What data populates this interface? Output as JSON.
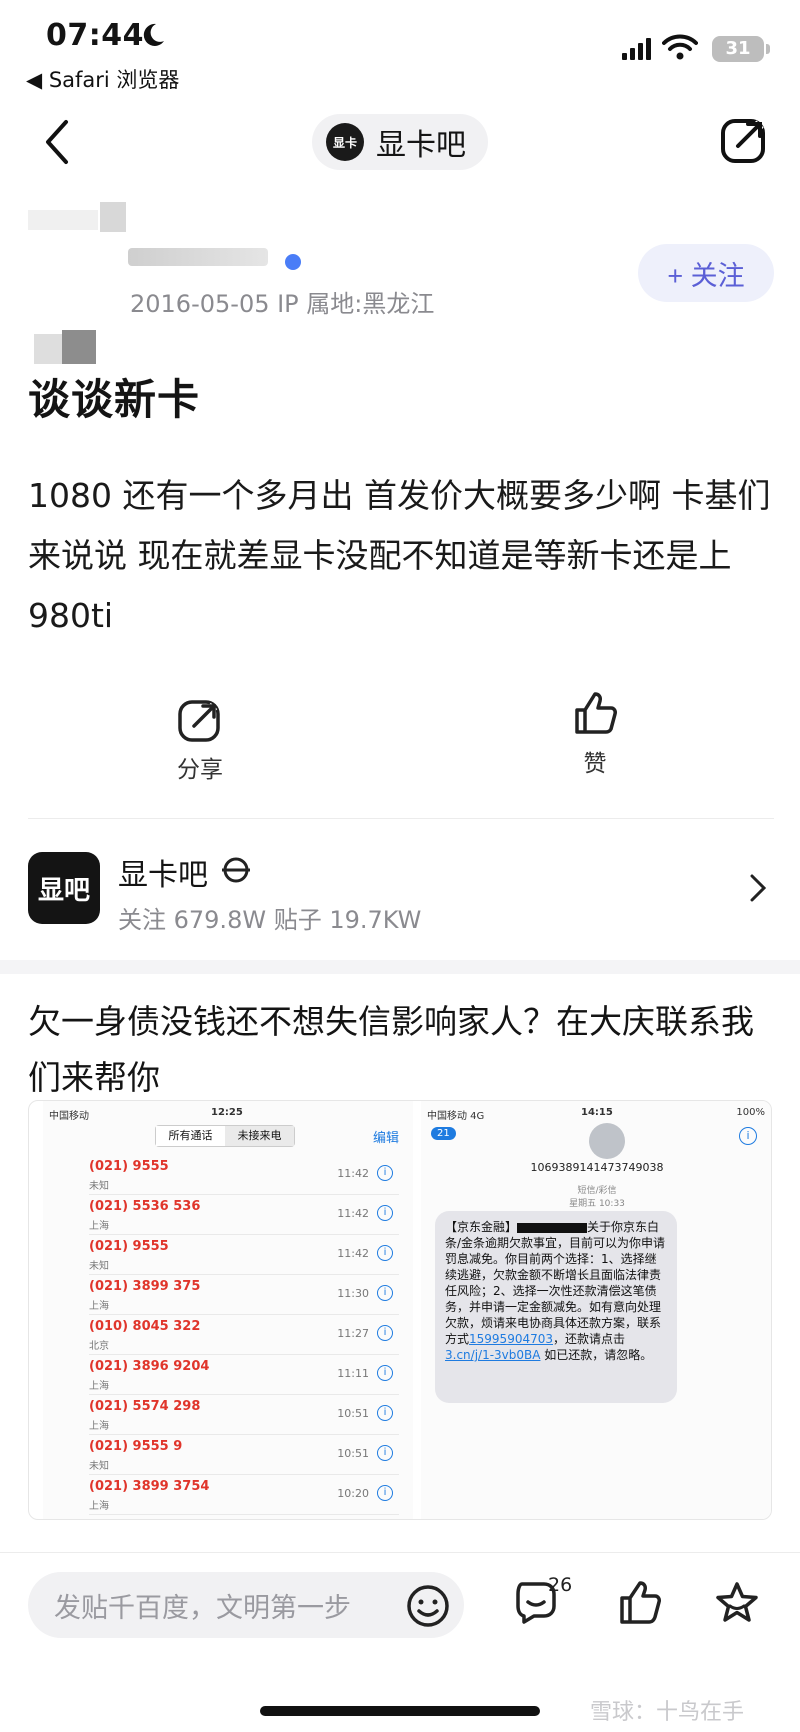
{
  "status": {
    "time": "07:44",
    "back_app": "◀ Safari 浏览器",
    "battery": "31"
  },
  "nav": {
    "forum_title": "显卡吧",
    "logo_text": "显卡"
  },
  "post": {
    "author_date_ip": "2016-05-05   IP 属地:黑龙江",
    "follow_label": "+ 关注",
    "title": "谈谈新卡",
    "body": "1080 还有一个多月出 首发价大概要多少啊 卡基们来说说 现在就差显卡没配不知道是等新卡还是上 980ti",
    "share_label": "分享",
    "like_label": "赞"
  },
  "forum": {
    "name": "显卡吧",
    "logo_text": "显吧",
    "stats": "关注 679.8W   贴子 19.7KW"
  },
  "ad": {
    "title": "欠一身债没钱还不想失信影响家人？在大庆联系我们来帮你",
    "left_screen": {
      "carrier": "中国移动",
      "time": "12:25",
      "tab_all": "所有通话",
      "tab_missed": "未接来电",
      "edit": "编辑",
      "calls": [
        {
          "num": "(021) 9555",
          "loc": "未知",
          "time": "11:42"
        },
        {
          "num": "(021) 5536 536",
          "loc": "上海",
          "time": "11:42"
        },
        {
          "num": "(021) 9555",
          "loc": "未知",
          "time": "11:42"
        },
        {
          "num": "(021) 3899 375",
          "loc": "上海",
          "time": "11:30"
        },
        {
          "num": "(010) 8045 322",
          "loc": "北京",
          "time": "11:27"
        },
        {
          "num": "(021) 3896 9204",
          "loc": "上海",
          "time": "11:11"
        },
        {
          "num": "(021) 5574 298",
          "loc": "上海",
          "time": "10:51"
        },
        {
          "num": "(021) 9555 9",
          "loc": "未知",
          "time": "10:51"
        },
        {
          "num": "(021) 3899 3754",
          "loc": "上海",
          "time": "10:20"
        }
      ]
    },
    "right_screen": {
      "carrier": "中国移动  4G",
      "time": "14:15",
      "battery": "100%",
      "back_count": "21",
      "sender": "1069389141473749038",
      "meta_line1": "短信/彩信",
      "meta_line2": "星期五 10:33",
      "msg_head": "【京东金融】",
      "msg_after_redact": "关于你京东白条/金条逾期欠款事宜，目前可以为你申请罚息减免。你目前两个选择：1、选择继续逃避，欠款金额不断增长且面临法律责任风险；2、选择一次性还款清偿这笔债务，并申请一定金额减免。如有意向处理欠款，烦请来电协商具体还款方案，联系方式",
      "msg_phone": "15995904703",
      "msg_mid": "，还款请点击",
      "msg_link": "3.cn/j/1-3vb0BA",
      "msg_tail": " 如已还款，请忽略。"
    }
  },
  "bottom": {
    "input_placeholder": "发贴千百度，文明第一步",
    "comment_count": "26"
  },
  "watermark": "雪球：十鸟在手"
}
